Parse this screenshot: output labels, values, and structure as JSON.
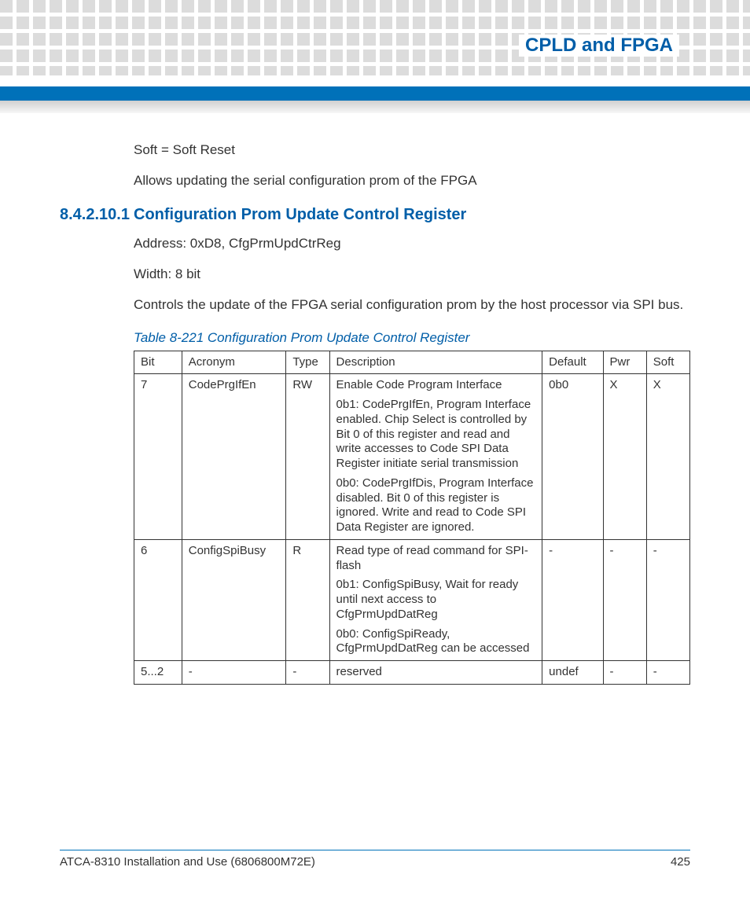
{
  "chapter_title": "CPLD and FPGA",
  "intro": {
    "line1": "Soft = Soft Reset",
    "line2": "Allows updating the serial configuration prom of the FPGA"
  },
  "section": {
    "number": "8.4.2.10.1",
    "title": "Configuration Prom Update Control Register",
    "address": "Address: 0xD8, CfgPrmUpdCtrReg",
    "width": "Width: 8 bit",
    "desc": "Controls the update of the FPGA serial configuration prom by the host processor via SPI bus."
  },
  "table": {
    "caption": "Table 8-221 Configuration Prom Update Control Register",
    "headers": {
      "bit": "Bit",
      "acronym": "Acronym",
      "type": "Type",
      "description": "Description",
      "default": "Default",
      "pwr": "Pwr",
      "soft": "Soft"
    },
    "rows": [
      {
        "bit": "7",
        "acronym": "CodePrgIfEn",
        "type": "RW",
        "desc0": "Enable Code Program Interface",
        "desc1": "0b1: CodePrgIfEn, Program Interface enabled. Chip Select is controlled by Bit 0 of this register and read and write accesses to Code SPI Data Register initiate serial transmission",
        "desc2": "0b0: CodePrgIfDis, Program Interface disabled. Bit 0 of this register is ignored. Write and read to Code SPI Data Register are ignored.",
        "default": "0b0",
        "pwr": "X",
        "soft": "X"
      },
      {
        "bit": "6",
        "acronym": "ConfigSpiBusy",
        "type": "R",
        "desc0": "Read type of read command for SPI-flash",
        "desc1": "0b1: ConfigSpiBusy, Wait for ready until next access to CfgPrmUpdDatReg",
        "desc2": "0b0: ConfigSpiReady, CfgPrmUpdDatReg can be accessed",
        "default": "-",
        "pwr": "-",
        "soft": "-"
      },
      {
        "bit": "5...2",
        "acronym": "-",
        "type": "-",
        "desc0": "reserved",
        "desc1": "",
        "desc2": "",
        "default": "undef",
        "pwr": "-",
        "soft": "-"
      }
    ]
  },
  "footer": {
    "doc": "ATCA-8310 Installation and Use (6806800M72E)",
    "page": "425"
  }
}
